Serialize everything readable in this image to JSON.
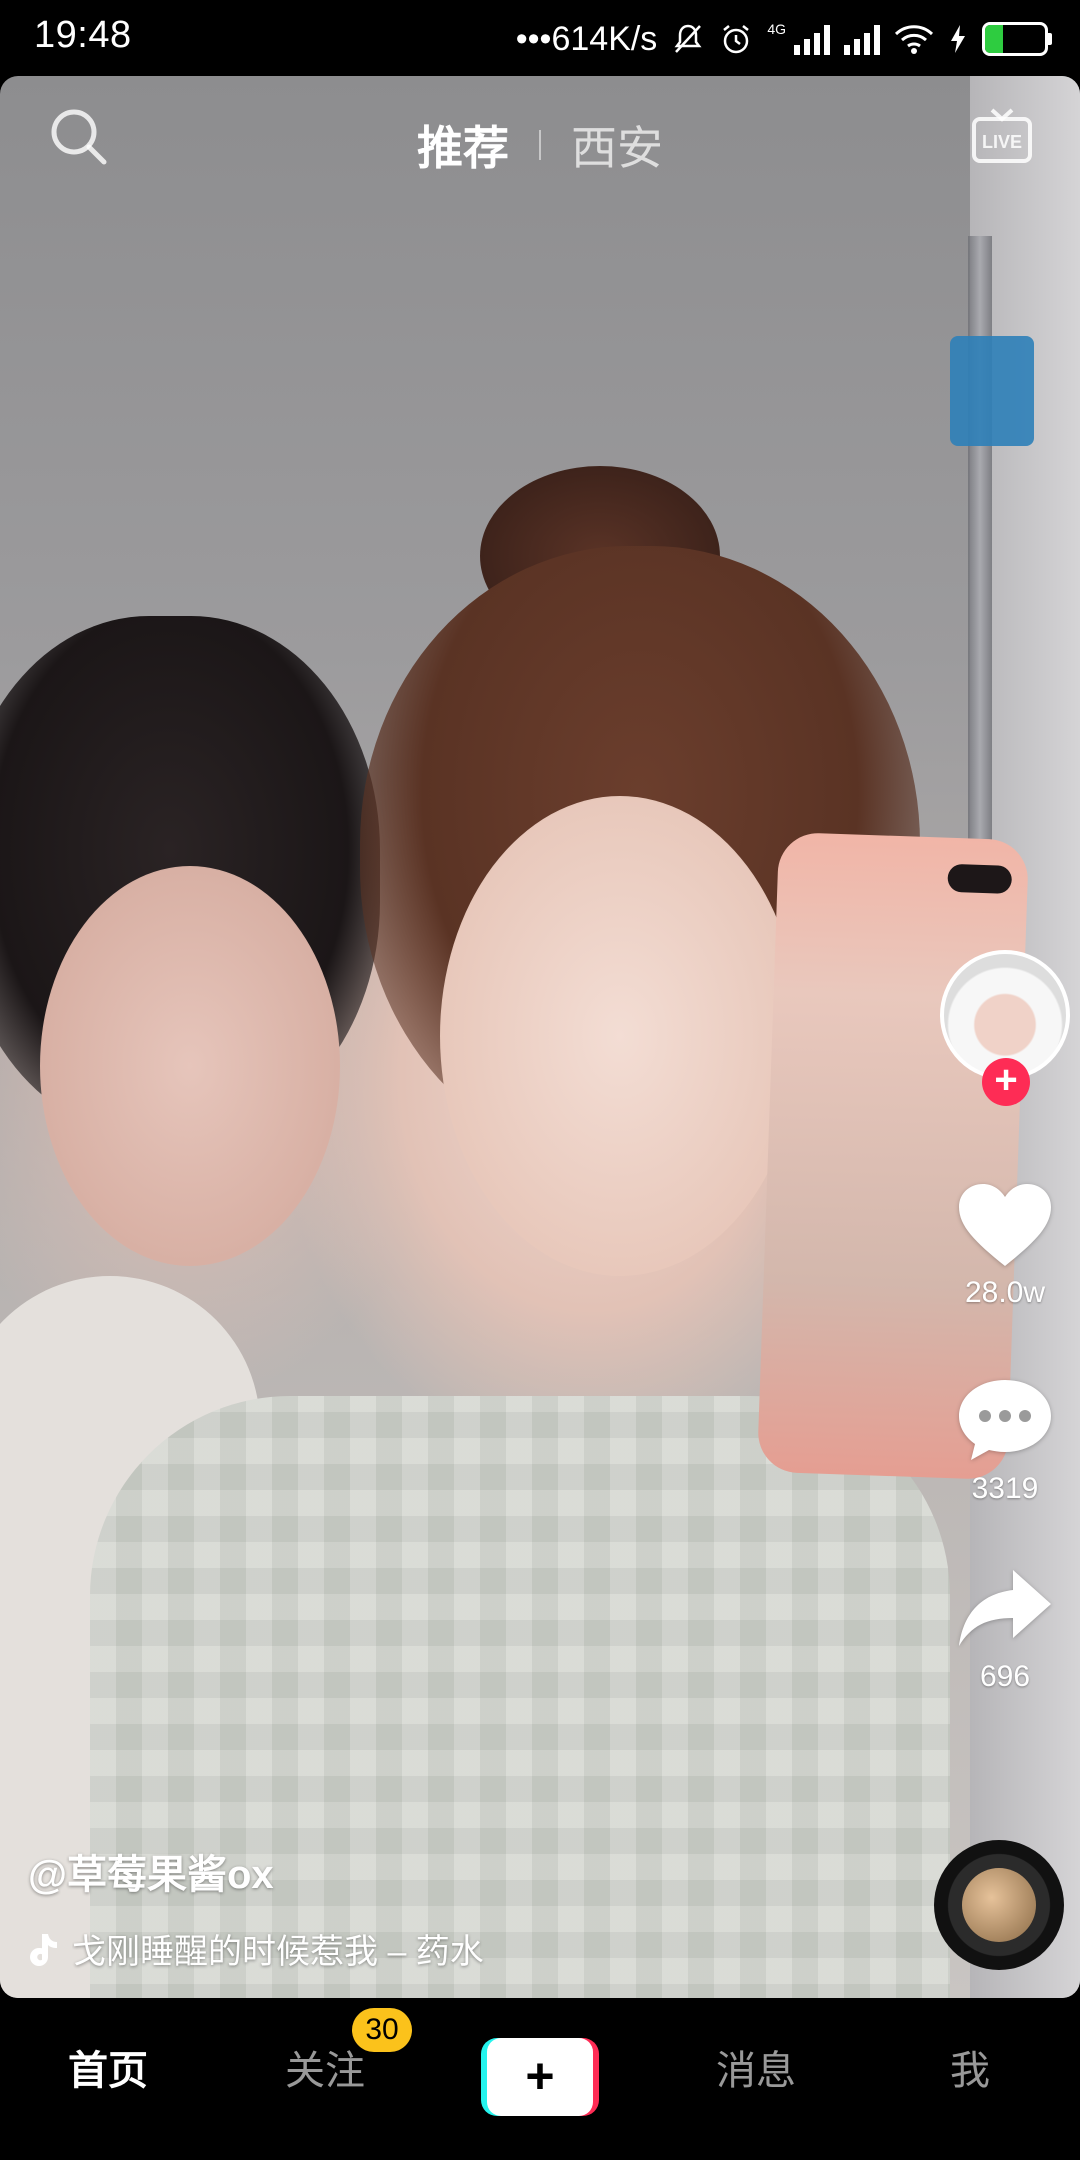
{
  "status_bar": {
    "time": "19:48",
    "net_speed": "•••614K/s",
    "network_type": "4G",
    "battery": "30",
    "battery_level": 0.3,
    "icons": [
      "mute-icon",
      "alarm-icon",
      "signal-4g-icon",
      "signal-icon",
      "wifi-icon",
      "charging-icon",
      "battery-icon"
    ]
  },
  "top_bar": {
    "tabs": [
      {
        "label": "推荐",
        "active": true
      },
      {
        "label": "西安",
        "active": false
      }
    ]
  },
  "right_rail": {
    "likes": "28.0w",
    "comments": "3319",
    "shares": "696"
  },
  "caption": {
    "author": "@草莓果酱ox",
    "music": "戈刚睡醒的时候惹我 – 药水"
  },
  "bottom_nav": {
    "home": "首页",
    "following": "关注",
    "following_badge": "30",
    "create": "+",
    "messages": "消息",
    "me": "我"
  },
  "colors": {
    "accent_red": "#fe2c55",
    "accent_cyan": "#25f4ee",
    "badge_yellow": "#fbc21b",
    "battery_green": "#2ecc40"
  }
}
